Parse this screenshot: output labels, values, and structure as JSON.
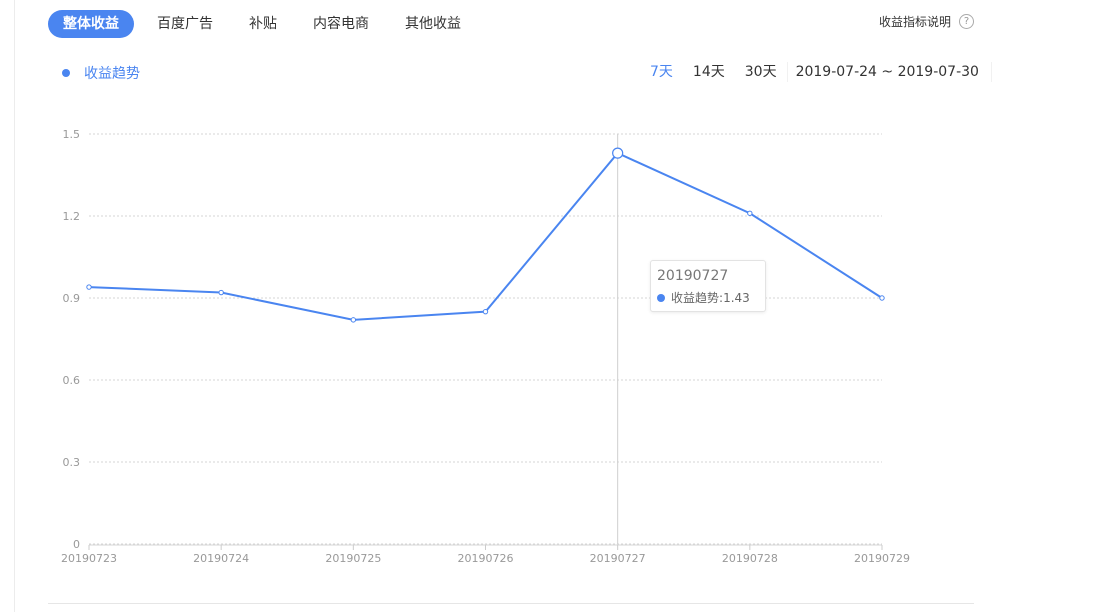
{
  "tabs": [
    {
      "label": "整体收益",
      "active": true
    },
    {
      "label": "百度广告",
      "active": false
    },
    {
      "label": "补贴",
      "active": false
    },
    {
      "label": "内容电商",
      "active": false
    },
    {
      "label": "其他收益",
      "active": false
    }
  ],
  "help": {
    "label": "收益指标说明",
    "icon": "question-circle-icon"
  },
  "legend": {
    "label": "收益趋势",
    "color": "#4a85f0"
  },
  "range": {
    "options": [
      {
        "label": "7天",
        "active": true
      },
      {
        "label": "14天",
        "active": false
      },
      {
        "label": "30天",
        "active": false
      }
    ],
    "date_range": "2019-07-24 ~ 2019-07-30"
  },
  "chart_data": {
    "type": "line",
    "categories": [
      "20190723",
      "20190724",
      "20190725",
      "20190726",
      "20190727",
      "20190728",
      "20190729"
    ],
    "series": [
      {
        "name": "收益趋势",
        "values": [
          0.94,
          0.92,
          0.82,
          0.85,
          1.43,
          1.21,
          0.9
        ],
        "color": "#4a85f0"
      }
    ],
    "yticks": [
      "0",
      "0.3",
      "0.6",
      "0.9",
      "1.2",
      "1.5"
    ],
    "ylim": [
      0,
      1.5
    ],
    "grid": true,
    "highlight_index": 4
  },
  "tooltip": {
    "title": "20190727",
    "series_name": "收益趋势",
    "separator": ":",
    "value": "1.43"
  }
}
